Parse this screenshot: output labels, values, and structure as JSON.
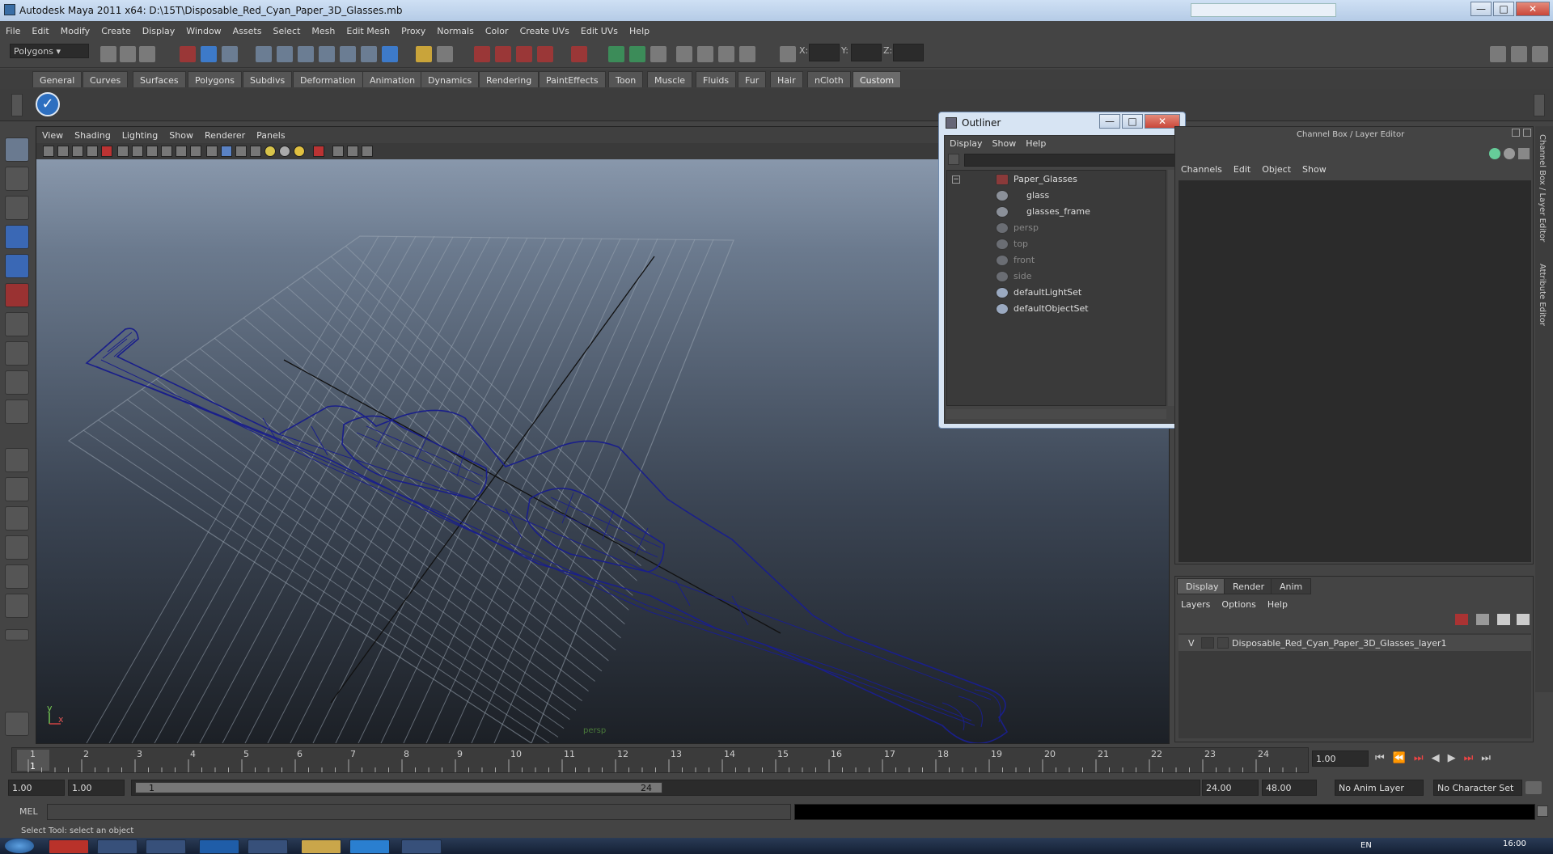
{
  "window": {
    "title": "Autodesk Maya 2011 x64: D:\\15T\\Disposable_Red_Cyan_Paper_3D_Glasses.mb",
    "min": "—",
    "max": "□",
    "close": "✕"
  },
  "menus": [
    "File",
    "Edit",
    "Modify",
    "Create",
    "Display",
    "Window",
    "Assets",
    "Select",
    "Mesh",
    "Edit Mesh",
    "Proxy",
    "Normals",
    "Color",
    "Create UVs",
    "Edit UVs",
    "Help"
  ],
  "toolbar": {
    "mode": "Polygons",
    "x": "X:",
    "y": "Y:",
    "z": "Z:"
  },
  "shelf_tabs": [
    "General",
    "Curves",
    "Surfaces",
    "Polygons",
    "Subdivs",
    "Deformation",
    "Animation",
    "Dynamics",
    "Rendering",
    "PaintEffects",
    "Toon",
    "Muscle",
    "Fluids",
    "Fur",
    "Hair",
    "nCloth",
    "Custom"
  ],
  "active_shelf": "Custom",
  "viewport": {
    "menus": [
      "View",
      "Shading",
      "Lighting",
      "Show",
      "Renderer",
      "Panels"
    ],
    "camera": "persp",
    "axis_y": "y",
    "axis_x": "x"
  },
  "outliner": {
    "title": "Outliner",
    "menus": [
      "Display",
      "Show",
      "Help"
    ],
    "items": [
      {
        "label": "Paper_Glasses",
        "dim": false
      },
      {
        "label": "glass",
        "dim": false
      },
      {
        "label": "glasses_frame",
        "dim": false
      },
      {
        "label": "persp",
        "dim": true
      },
      {
        "label": "top",
        "dim": true
      },
      {
        "label": "front",
        "dim": true
      },
      {
        "label": "side",
        "dim": true
      },
      {
        "label": "defaultLightSet",
        "dim": false
      },
      {
        "label": "defaultObjectSet",
        "dim": false
      }
    ]
  },
  "channel_box": {
    "header": "Channel Box / Layer Editor",
    "menus": [
      "Channels",
      "Edit",
      "Object",
      "Show"
    ]
  },
  "layer_editor": {
    "tabs": [
      "Display",
      "Render",
      "Anim"
    ],
    "menus": [
      "Layers",
      "Options",
      "Help"
    ],
    "layer_visible": "V",
    "layer_name": "Disposable_Red_Cyan_Paper_3D_Glasses_layer1"
  },
  "side_tabs": [
    "Channel Box / Layer Editor",
    "Attribute Editor"
  ],
  "timeline": {
    "ticks": [
      "1",
      "2",
      "3",
      "4",
      "5",
      "6",
      "7",
      "8",
      "9",
      "10",
      "11",
      "12",
      "13",
      "14",
      "15",
      "16",
      "17",
      "18",
      "19",
      "20",
      "21",
      "22",
      "23",
      "24"
    ],
    "current_frame": "1",
    "current_time": "1.00"
  },
  "range": {
    "start": "1.00",
    "start2": "1.00",
    "inner_start": "1",
    "inner_end": "24",
    "end": "24.00",
    "end2": "48.00",
    "anim_layer": "No Anim Layer",
    "char_set": "No Character Set"
  },
  "mel": {
    "label": "MEL"
  },
  "helpline": "Select Tool: select an object",
  "taskbar": {
    "lang": "EN",
    "clock": "16:00"
  }
}
